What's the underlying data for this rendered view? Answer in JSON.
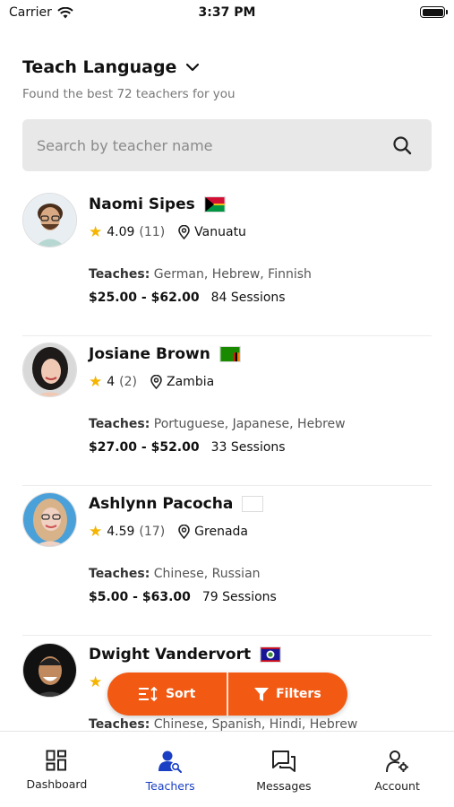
{
  "status": {
    "carrier": "Carrier",
    "time": "3:37 PM"
  },
  "header": {
    "title": "Teach Language",
    "subtitle": "Found the best 72 teachers for you"
  },
  "search": {
    "placeholder": "Search by teacher name",
    "value": ""
  },
  "teachers": [
    {
      "name": "Naomi Sipes",
      "rating": "4.09",
      "reviews": "(11)",
      "location": "Vanuatu",
      "teaches_label": "Teaches:",
      "languages": "German, Hebrew, Finnish",
      "price": "$25.00 - $62.00",
      "sessions": "84 Sessions"
    },
    {
      "name": "Josiane Brown",
      "rating": "4",
      "reviews": "(2)",
      "location": "Zambia",
      "teaches_label": "Teaches:",
      "languages": "Portuguese, Japanese, Hebrew",
      "price": "$27.00 - $52.00",
      "sessions": "33 Sessions"
    },
    {
      "name": "Ashlynn Pacocha",
      "rating": "4.59",
      "reviews": "(17)",
      "location": "Grenada",
      "teaches_label": "Teaches:",
      "languages": "Chinese, Russian",
      "price": "$5.00 - $63.00",
      "sessions": "79 Sessions"
    },
    {
      "name": "Dwight Vandervort",
      "rating": "",
      "reviews": "",
      "location": "",
      "teaches_label": "Teaches:",
      "languages": "Chinese, Spanish, Hindi, Hebrew",
      "price": "",
      "sessions": ""
    }
  ],
  "actions": {
    "sort": "Sort",
    "filters": "Filters"
  },
  "tabs": [
    {
      "label": "Dashboard",
      "icon": "dashboard-icon"
    },
    {
      "label": "Teachers",
      "icon": "teachers-icon",
      "active": true
    },
    {
      "label": "Messages",
      "icon": "messages-icon"
    },
    {
      "label": "Account",
      "icon": "account-icon"
    }
  ],
  "colors": {
    "accent": "#f25a14",
    "active_tab": "#1a3fc4",
    "star": "#f5b400"
  }
}
